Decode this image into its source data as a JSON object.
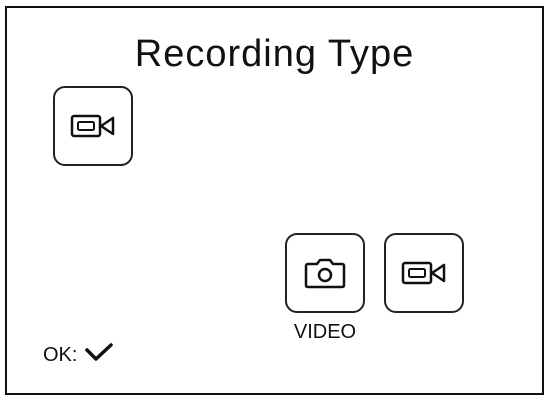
{
  "screen": {
    "title": "Recording Type"
  },
  "current_mode": {
    "icon": "video-camera-icon"
  },
  "options": [
    {
      "icon": "photo-camera-icon",
      "label": "VIDEO"
    },
    {
      "icon": "video-camera-icon"
    }
  ],
  "footer": {
    "ok_label": "OK:",
    "ok_icon": "checkmark-icon"
  },
  "colors": {
    "foreground": "#111111",
    "background": "#ffffff"
  }
}
